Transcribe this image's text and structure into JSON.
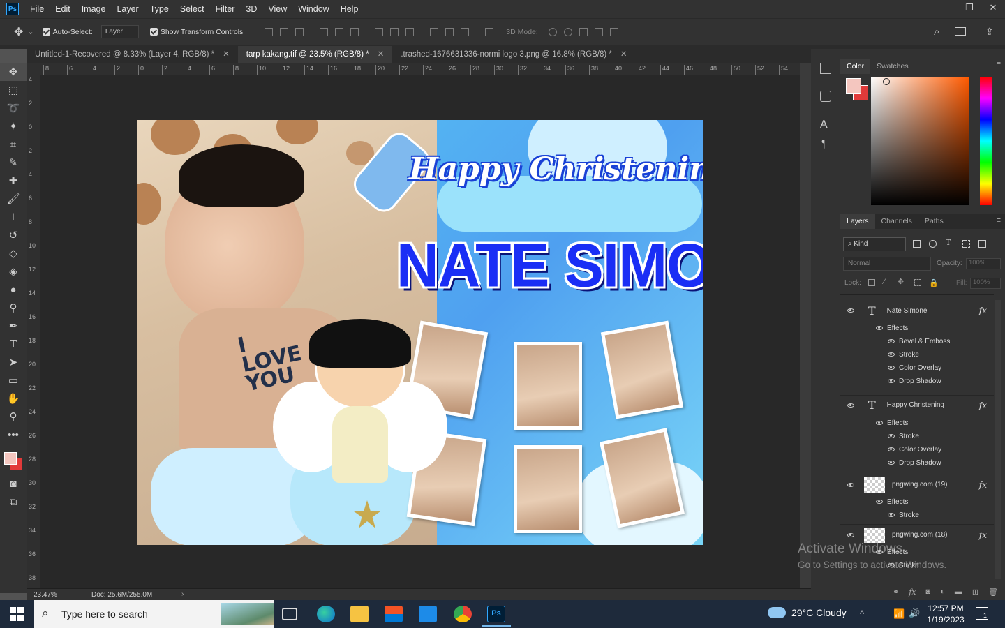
{
  "app": {
    "logo": "Ps"
  },
  "menu": [
    "File",
    "Edit",
    "Image",
    "Layer",
    "Type",
    "Select",
    "Filter",
    "3D",
    "View",
    "Window",
    "Help"
  ],
  "window_controls": [
    "–",
    "❐",
    "✕"
  ],
  "options": {
    "auto_select_label": "Auto-Select:",
    "auto_select_target": "Layer",
    "show_transform_label": "Show Transform Controls",
    "mode_label": "3D Mode:"
  },
  "tabs": [
    {
      "label": "Untitled-1-Recovered @ 8.33% (Layer 4, RGB/8) *",
      "active": false
    },
    {
      "label": "tarp kakang.tif @ 23.5% (RGB/8) *",
      "active": true
    },
    {
      "label": ".trashed-1676631336-normi logo 3.png @ 16.8% (RGB/8) *",
      "active": false
    }
  ],
  "ruler_top": [
    "8",
    "6",
    "4",
    "2",
    "0",
    "2",
    "4",
    "6",
    "8",
    "10",
    "12",
    "14",
    "16",
    "18",
    "20",
    "22",
    "24",
    "26",
    "28",
    "30",
    "32",
    "34",
    "36",
    "38",
    "40",
    "42",
    "44",
    "46",
    "48",
    "50",
    "52",
    "54"
  ],
  "ruler_left": [
    "4",
    "2",
    "0",
    "2",
    "4",
    "6",
    "8",
    "10",
    "12",
    "14",
    "16",
    "18",
    "20",
    "22",
    "24",
    "26",
    "28",
    "30",
    "32",
    "34",
    "36",
    "38"
  ],
  "status": {
    "zoom": "23.47%",
    "doc": "Doc: 25.6M/255.0M"
  },
  "canvas": {
    "title_script": "Happy Christening",
    "name": "NATE SIMONE",
    "shirt_text": "I LOVE YOU"
  },
  "panels": {
    "color_tabs": [
      "Color",
      "Swatches"
    ],
    "layer_tabs": [
      "Layers",
      "Channels",
      "Paths"
    ],
    "kind": "Kind",
    "blend": "Normal",
    "opacity_label": "Opacity:",
    "opacity": "100%",
    "lock_label": "Lock:",
    "fill_label": "Fill:",
    "fill": "100%"
  },
  "layers": [
    {
      "name": "Nate Simone",
      "type": "text",
      "effects_label": "Effects",
      "effects": [
        "Bevel & Emboss",
        "Stroke",
        "Color Overlay",
        "Drop Shadow"
      ]
    },
    {
      "name": "Happy Christening",
      "type": "text",
      "effects_label": "Effects",
      "effects": [
        "Stroke",
        "Color Overlay",
        "Drop Shadow"
      ]
    },
    {
      "name": "pngwing.com (19)",
      "type": "image",
      "effects_label": "Effects",
      "effects": [
        "Stroke"
      ]
    },
    {
      "name": "pngwing.com (18)",
      "type": "image",
      "effects_label": "Effects",
      "effects": [
        "Stroke"
      ]
    }
  ],
  "watermark": {
    "line1": "Activate Windows",
    "line2": "Go to Settings to activate Windows."
  },
  "taskbar": {
    "search_placeholder": "Type here to search",
    "weather": "29°C  Cloudy",
    "time": "12:57 PM",
    "date": "1/19/2023",
    "notif_count": "1"
  },
  "colors": {
    "foreground": "#f4c6bf",
    "background": "#e23a3a",
    "hue": "#ff5a00"
  }
}
